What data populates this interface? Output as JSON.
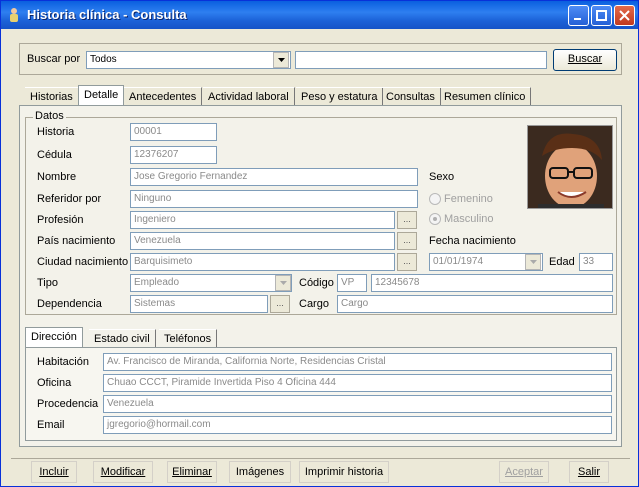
{
  "window": {
    "title": "Historia clínica - Consulta",
    "app_icon": "person-icon"
  },
  "search": {
    "label": "Buscar por",
    "mode_value": "Todos",
    "query_value": "",
    "button_label": "Buscar"
  },
  "tabs": [
    "Historias",
    "Detalle",
    "Antecedentes",
    "Actividad laboral",
    "Peso y estatura",
    "Consultas",
    "Resumen clínico"
  ],
  "active_tab": "Detalle",
  "datos": {
    "group_label": "Datos",
    "historia_label": "Historia",
    "historia_value": "00001",
    "cedula_label": "Cédula",
    "cedula_value": "12376207",
    "nombre_label": "Nombre",
    "nombre_value": "Jose Gregorio Fernandez",
    "referidor_label": "Referidor por",
    "referidor_value": "Ninguno",
    "profesion_label": "Profesión",
    "profesion_value": "Ingeniero",
    "pais_label": "País nacimiento",
    "pais_value": "Venezuela",
    "ciudad_label": "Ciudad nacimiento",
    "ciudad_value": "Barquisimeto",
    "tipo_label": "Tipo",
    "tipo_value": "Empleado",
    "codigo_label": "Código",
    "codigo_prefix": "VP",
    "codigo_value": "12345678",
    "dependencia_label": "Dependencia",
    "dependencia_value": "Sistemas",
    "cargo_label": "Cargo",
    "cargo_value": "Cargo",
    "sexo_label": "Sexo",
    "sexo_options": [
      "Femenino",
      "Masculino"
    ],
    "sexo_selected": "Masculino",
    "fecha_label": "Fecha nacimiento",
    "fecha_value": "01/01/1974",
    "edad_label": "Edad",
    "edad_value": "33"
  },
  "subtabs": [
    "Dirección",
    "Estado civil",
    "Teléfonos"
  ],
  "active_subtab": "Dirección",
  "direccion": {
    "habitacion_label": "Habitación",
    "habitacion_value": "Av. Francisco de Miranda, California Norte, Residencias Cristal",
    "oficina_label": "Oficina",
    "oficina_value": "Chuao CCCT, Piramide Invertida Piso 4 Oficina 444",
    "procedencia_label": "Procedencia",
    "procedencia_value": "Venezuela",
    "email_label": "Email",
    "email_value": "jgregorio@hormail.com"
  },
  "toolbar": {
    "incluir": "Incluir",
    "modificar": "Modificar",
    "eliminar": "Eliminar",
    "imagenes": "Imágenes",
    "imprimir": "Imprimir historia",
    "aceptar": "Aceptar",
    "salir": "Salir"
  }
}
